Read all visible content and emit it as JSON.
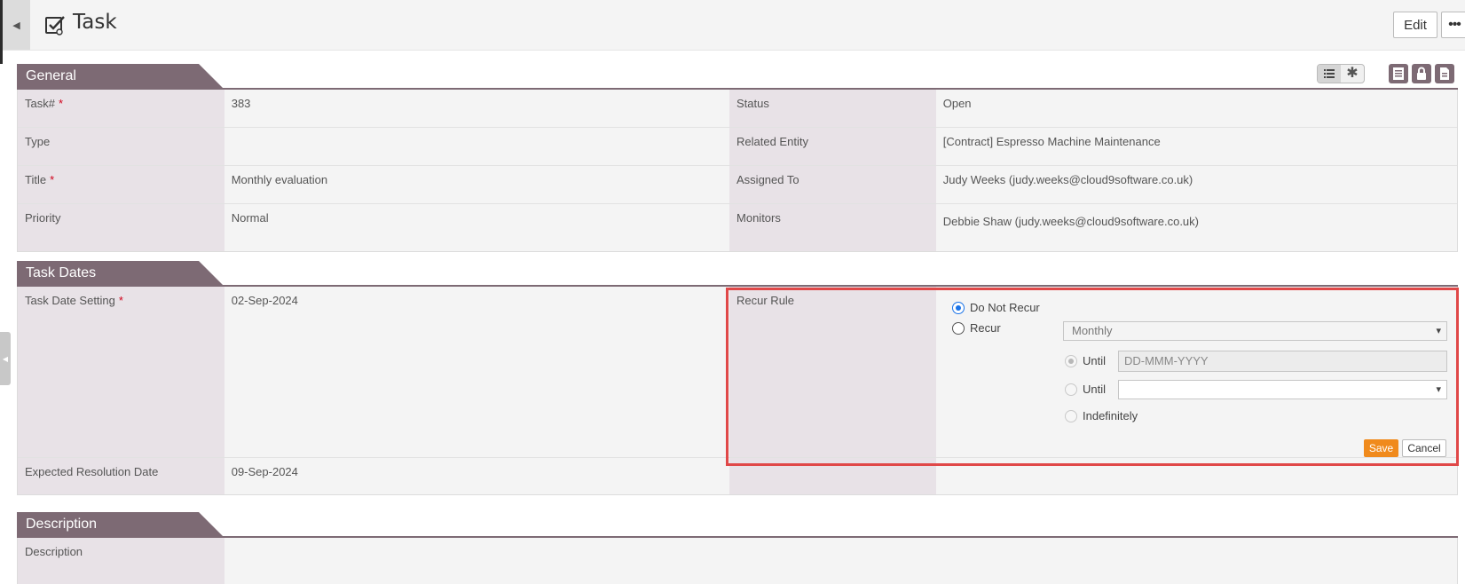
{
  "header": {
    "title": "Task",
    "edit_label": "Edit",
    "more_label": "•••"
  },
  "toolbar": {
    "list_view_icon": "list-icon",
    "required_only_icon": "asterisk-icon",
    "icons": [
      "form-icon",
      "lock-icon",
      "document-icon"
    ]
  },
  "general": {
    "title": "General",
    "rows": [
      {
        "label": "Task#",
        "required": "*",
        "value": "383",
        "label2": "Status",
        "value2": "Open"
      },
      {
        "label": "Type",
        "required": "",
        "value": "",
        "label2": "Related Entity",
        "value2": "[Contract] Espresso Machine Maintenance"
      },
      {
        "label": "Title",
        "required": "*",
        "value": "Monthly evaluation",
        "label2": "Assigned To",
        "value2": "Judy Weeks (judy.weeks@cloud9software.co.uk)"
      },
      {
        "label": "Priority",
        "required": "",
        "value": "Normal",
        "label2": "Monitors",
        "value2": "Debbie Shaw (judy.weeks@cloud9software.co.uk)"
      }
    ]
  },
  "task_dates": {
    "title": "Task Dates",
    "task_date_label": "Task Date Setting",
    "task_date_required": "*",
    "task_date_value": "02-Sep-2024",
    "recur_rule_label": "Recur Rule",
    "expected_label": "Expected Resolution Date",
    "expected_value": "09-Sep-2024",
    "recur": {
      "do_not_recur_label": "Do Not Recur",
      "recur_label": "Recur",
      "frequency_value": "Monthly",
      "until_label": "Until",
      "until_date_placeholder": "DD-MMM-YYYY",
      "until2_label": "Until",
      "until2_value": "",
      "indefinitely_label": "Indefinitely",
      "save_label": "Save",
      "cancel_label": "Cancel",
      "selected": "Do Not Recur"
    }
  },
  "description": {
    "title": "Description",
    "label": "Description",
    "value": ""
  },
  "colors": {
    "section_header": "#7d6a74",
    "label_bg": "#e8e2e7",
    "value_bg": "#f4f4f4",
    "save_button": "#f08a1c",
    "highlight_border": "#e04848",
    "required": "#d0021b"
  }
}
